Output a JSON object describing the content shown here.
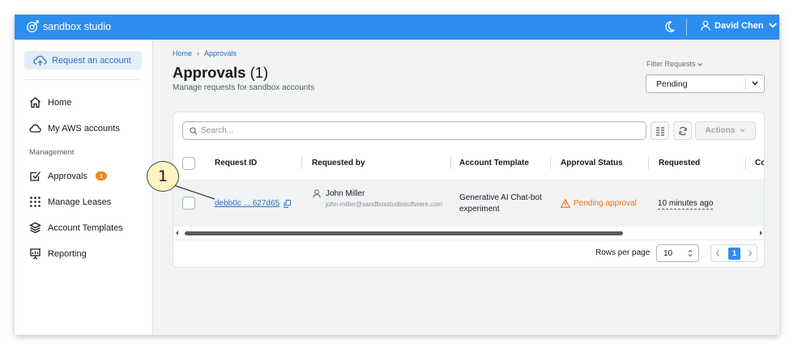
{
  "topbar": {
    "brand": "sandbox studio",
    "user_name": "David Chen",
    "accent_color": "#2d8ef0"
  },
  "sidebar": {
    "request_button": "Request an account",
    "items": [
      {
        "label": "Home",
        "icon": "home-icon"
      },
      {
        "label": "My AWS accounts",
        "icon": "cloud-icon"
      }
    ],
    "section_heading": "Management",
    "management_items": [
      {
        "label": "Approvals",
        "icon": "checkbox-icon",
        "badge": "1"
      },
      {
        "label": "Manage Leases",
        "icon": "grid-dots-icon"
      },
      {
        "label": "Account Templates",
        "icon": "layers-icon"
      },
      {
        "label": "Reporting",
        "icon": "presentation-icon"
      }
    ]
  },
  "breadcrumb": [
    "Home",
    "Approvals"
  ],
  "page": {
    "title": "Approvals",
    "count": "(1)",
    "subtitle": "Manage requests for sandbox accounts"
  },
  "filter": {
    "label": "Filter Requests",
    "value": "Pending"
  },
  "table": {
    "search_placeholder": "Search...",
    "actions_label": "Actions",
    "columns": [
      "Request ID",
      "Requested by",
      "Account Template",
      "Approval Status",
      "Requested",
      "Co"
    ],
    "rows": [
      {
        "request_id": "debb0c ... 627d65",
        "requested_by_name": "John Miller",
        "requested_by_email": "john-miller@sandboxstudiosoftware.com",
        "account_template": "Generative AI Chat-bot experiment",
        "approval_status": "Pending approval",
        "requested": "10 minutes ago"
      }
    ],
    "rows_per_page_label": "Rows per page",
    "rows_per_page_value": "10",
    "current_page": "1"
  },
  "annotation": {
    "callout_number": "1"
  }
}
